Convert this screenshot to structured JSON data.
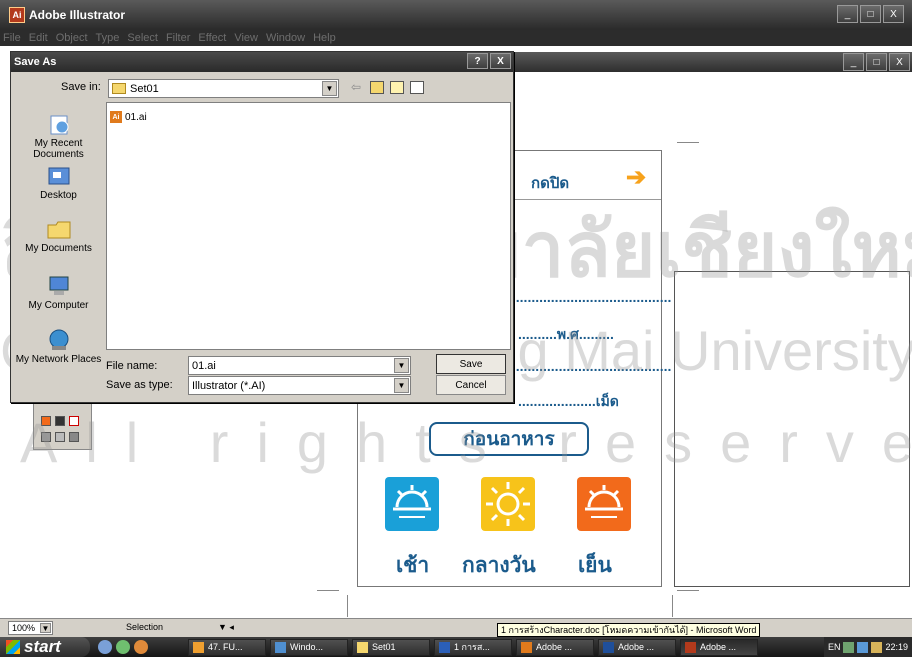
{
  "app": {
    "title": "Adobe Illustrator"
  },
  "menubar": [
    "File",
    "Edit",
    "Object",
    "Type",
    "Select",
    "Filter",
    "Effect",
    "View",
    "Window",
    "Help"
  ],
  "window_controls": {
    "minimize": "_",
    "maximize": "□",
    "close": "X"
  },
  "dialog": {
    "title": "Save As",
    "help_btn": "?",
    "close_btn": "X",
    "save_in_label": "Save in:",
    "save_in_value": "Set01",
    "places": [
      "My Recent Documents",
      "Desktop",
      "My Documents",
      "My Computer",
      "My Network Places"
    ],
    "files": [
      {
        "name": "01.ai"
      }
    ],
    "file_name_label": "File name:",
    "file_name_value": "01.ai",
    "save_type_label": "Save as type:",
    "save_type_value": "Illustrator (*.AI)",
    "save_button": "Save",
    "cancel_button": "Cancel"
  },
  "artwork": {
    "press_open": "กดปิด",
    "arrow": "➔",
    "dots_line1": "..........................................",
    "dots_line2": "..........พ.ศ.........",
    "dots_line3": "..........................................",
    "dots_line4": "....................เม็ด",
    "before_meal": "ก่อนอาหาร",
    "morning": "เช้า",
    "noon": "กลางวัน",
    "evening": "เย็น",
    "sun_colors": {
      "morning": "#1aa0d8",
      "noon": "#f7c31a",
      "evening": "#f26a1b"
    }
  },
  "watermark": {
    "line1": "ลิขสิทธิ์มหาวิทยาลัยเชียงใหม่",
    "line2": "Copyright© by Chiang Mai University",
    "line3": "All rights reserved"
  },
  "statusbar": {
    "zoom": "100%",
    "tool": "Selection"
  },
  "tooltip": "1 การสร้างCharacter.doc [โหมดความเข้ากันได้] - Microsoft Word",
  "taskbar": {
    "start": "start",
    "tasks": [
      "47. FU...",
      "Windo...",
      "Set01",
      "1 การส...",
      "Adobe ...",
      "Adobe ...",
      "Adobe ..."
    ],
    "lang": "EN",
    "clock": "22:19"
  }
}
